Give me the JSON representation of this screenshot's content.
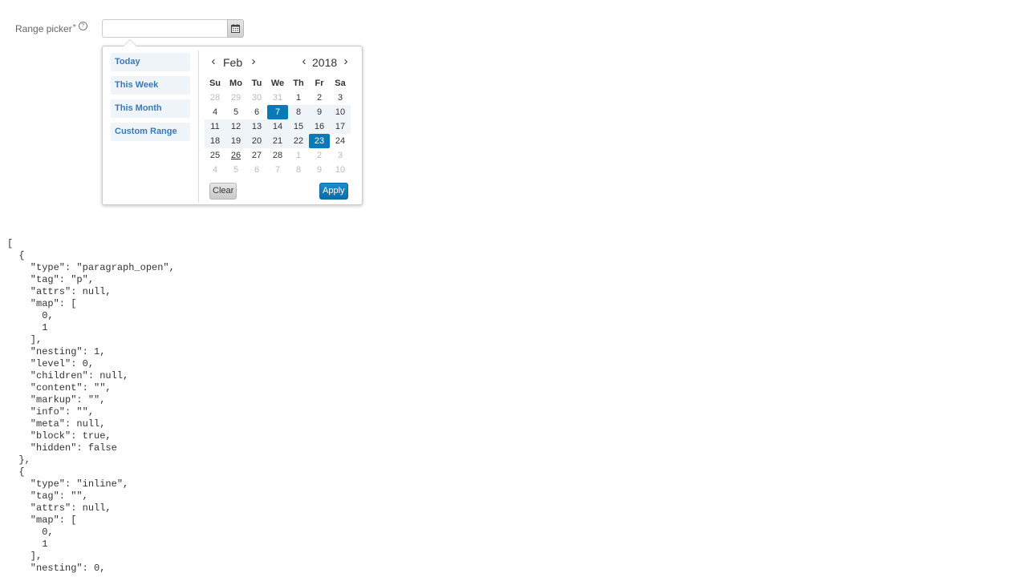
{
  "form": {
    "label": "Range picker",
    "required_mark": "*",
    "help_glyph": "?",
    "input_value": "",
    "input_placeholder": ""
  },
  "picker": {
    "ranges": [
      "Today",
      "This Week",
      "This Month",
      "Custom Range"
    ],
    "month": "Feb",
    "year": "2018",
    "prev_glyph": "‹",
    "next_glyph": "›",
    "weekdays": [
      "Su",
      "Mo",
      "Tu",
      "We",
      "Th",
      "Fr",
      "Sa"
    ],
    "weeks": [
      [
        "28",
        "29",
        "30",
        "31",
        "1",
        "2",
        "3"
      ],
      [
        "4",
        "5",
        "6",
        "7",
        "8",
        "9",
        "10"
      ],
      [
        "11",
        "12",
        "13",
        "14",
        "15",
        "16",
        "17"
      ],
      [
        "18",
        "19",
        "20",
        "21",
        "22",
        "23",
        "24"
      ],
      [
        "25",
        "26",
        "27",
        "28",
        "1",
        "2",
        "3"
      ],
      [
        "4",
        "5",
        "6",
        "7",
        "8",
        "9",
        "10"
      ]
    ],
    "range_start": "7",
    "range_end": "23",
    "today": "26",
    "clear_label": "Clear",
    "apply_label": "Apply",
    "colors": {
      "selected": "#0a7ab7",
      "in_range": "#eff4f9",
      "range_text": "#3b78b4"
    }
  },
  "dump_text": "[\n  {\n    \"type\": \"paragraph_open\",\n    \"tag\": \"p\",\n    \"attrs\": null,\n    \"map\": [\n      0,\n      1\n    ],\n    \"nesting\": 1,\n    \"level\": 0,\n    \"children\": null,\n    \"content\": \"\",\n    \"markup\": \"\",\n    \"info\": \"\",\n    \"meta\": null,\n    \"block\": true,\n    \"hidden\": false\n  },\n  {\n    \"type\": \"inline\",\n    \"tag\": \"\",\n    \"attrs\": null,\n    \"map\": [\n      0,\n      1\n    ],\n    \"nesting\": 0,"
}
